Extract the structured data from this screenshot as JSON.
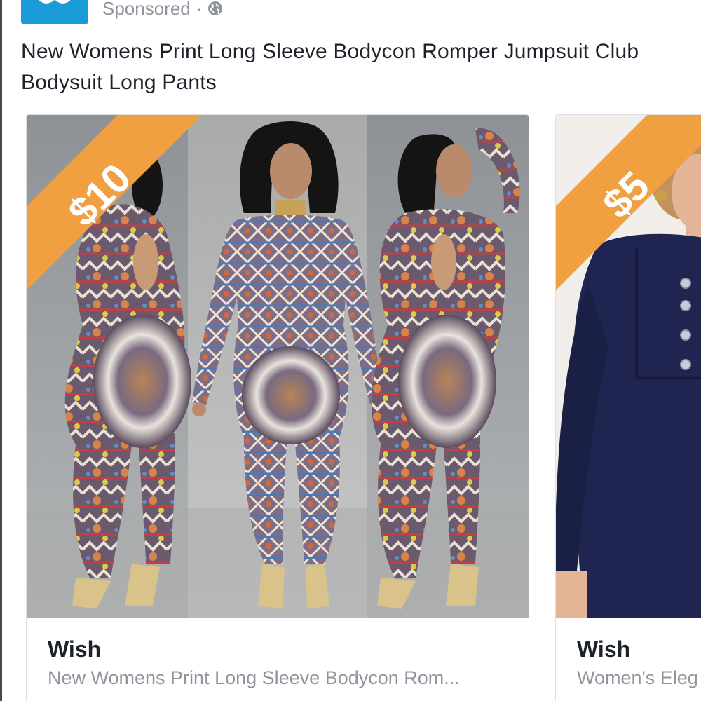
{
  "post": {
    "sponsored_label": "Sponsored",
    "separator": "·",
    "privacy_icon": "globe-icon",
    "title": "New Womens Print Long Sleeve Bodycon Romper Jumpsuit Club Bodysuit Long Pants"
  },
  "carousel": {
    "cards": [
      {
        "price": "$10",
        "store": "Wish",
        "description": "New Womens Print Long Sleeve Bodycon Rom..."
      },
      {
        "price": "$5",
        "store": "Wish",
        "description": "Women's Eleg"
      }
    ]
  },
  "colors": {
    "ribbon": "#f0a040",
    "avatar": "#1a9bd7",
    "meta_text": "#90949c",
    "title_text": "#1d2129",
    "navy_dress": "#1f2550"
  }
}
